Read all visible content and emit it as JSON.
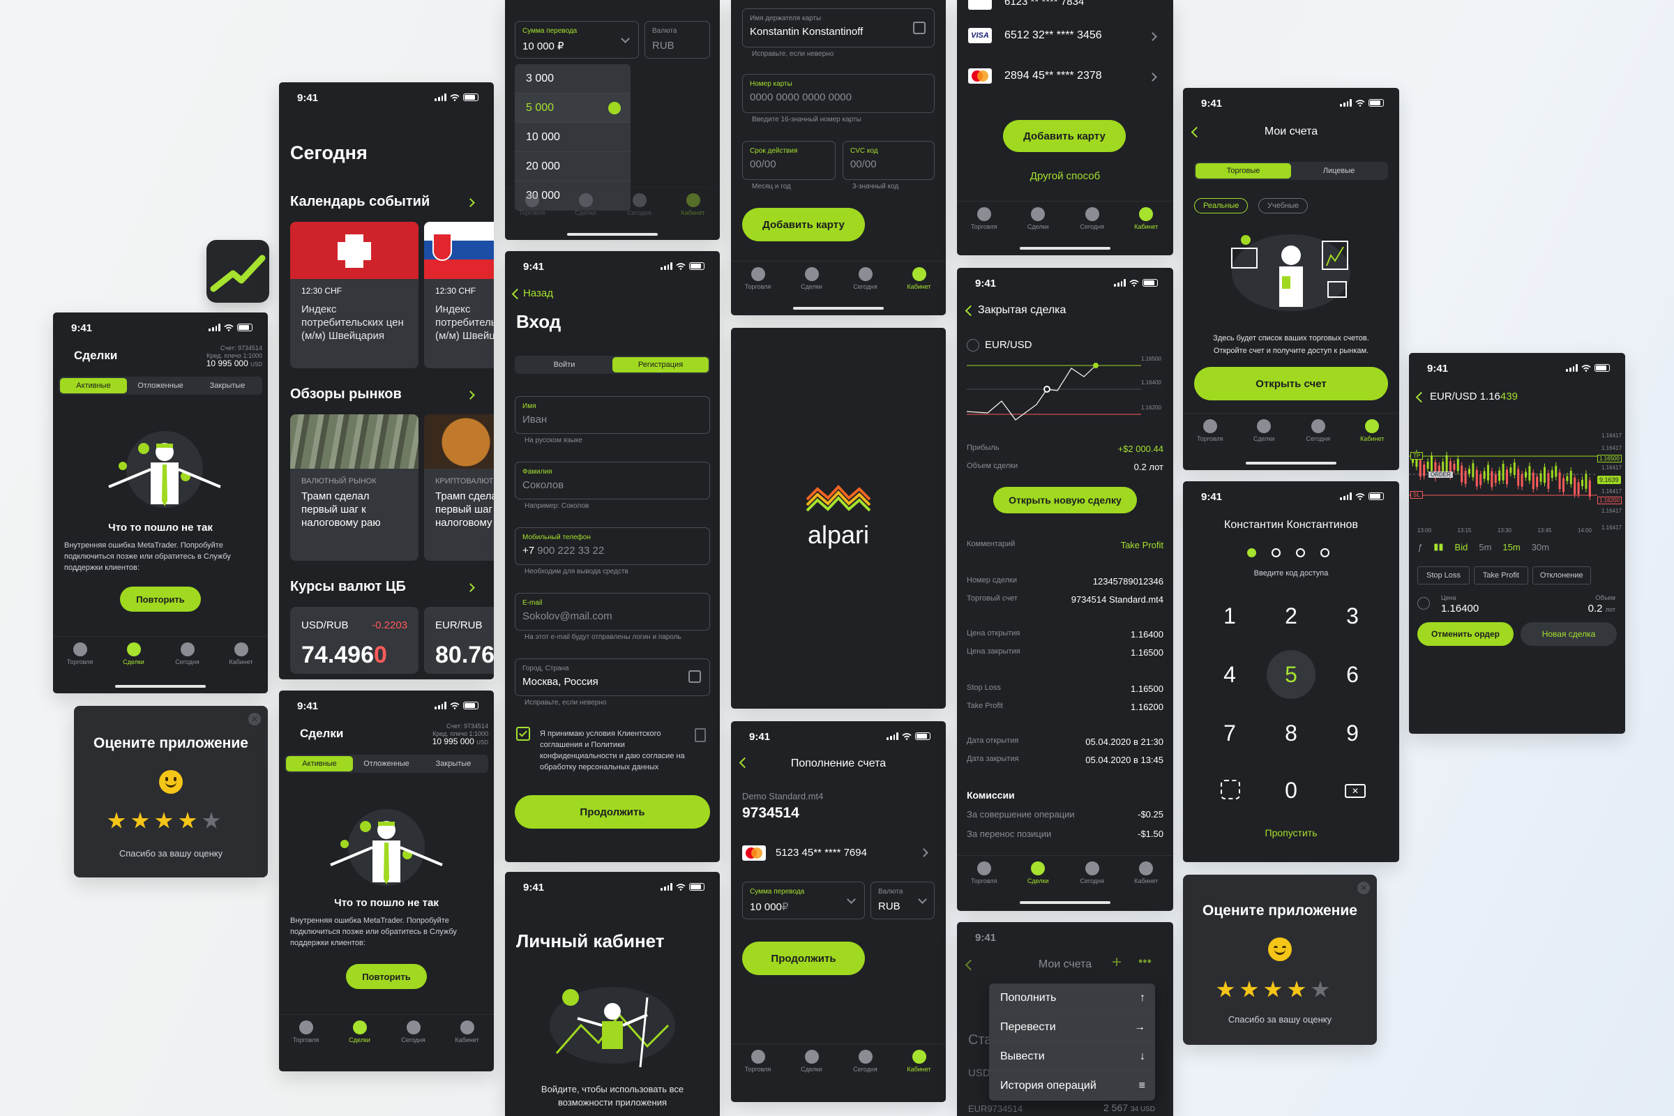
{
  "status_time": "9:41",
  "tabs": [
    "Торговля",
    "Сделки",
    "Сегодня",
    "Кабинет"
  ],
  "deals1": {
    "title": "Сделки",
    "acc": "Счет: 9734514",
    "leverage": "Кред. плечо 1:1000",
    "balance": "10 995 000",
    "cur": "USD",
    "seg": [
      "Активные",
      "Отложенные",
      "Закрытые"
    ],
    "err_title": "Что то пошло не так",
    "err_text": "Внутренняя ошибка MetaTrader. Попробуйте подключиться позже или обратитесь в Службу поддержки клиентов:",
    "retry": "Повторить"
  },
  "rate1": {
    "title": "Оцените приложение",
    "thanks": "Спасибо за вашу оценку"
  },
  "today": {
    "title": "Сегодня",
    "cal": "Календарь событий",
    "events": [
      {
        "time": "12:30 CHF",
        "text": "Индекс потребительских цен (м/м) Швейцария"
      },
      {
        "time": "12:30 CHF",
        "text": "Индекс потребительских цен (м/м) Швейцария"
      }
    ],
    "reviews": "Обзоры рынков",
    "news": [
      {
        "cat": "ВАЛЮТНЫЙ РЫНОК",
        "text": "Трамп сделал первый шаг к налоговому раю"
      },
      {
        "cat": "КРИПТОВАЛЮТЫ",
        "text": "Трамп сделал первый шаг к налоговому раю"
      }
    ],
    "rates": "Курсы валют ЦБ",
    "pairs": [
      {
        "pair": "USD/RUB",
        "chg": "-0.2203",
        "main": "74.496",
        "last": "0"
      },
      {
        "pair": "EUR/RUB",
        "main": "80.76"
      }
    ]
  },
  "transfer": {
    "amount_label": "Сумма перевода",
    "amount": "10 000 ₽",
    "cur_label": "Валюта",
    "cur": "RUB",
    "options": [
      "3 000",
      "5 000",
      "10 000",
      "20 000",
      "30 000"
    ]
  },
  "login": {
    "back": "Назад",
    "title": "Вход",
    "seg": [
      "Войти",
      "Регистрация"
    ],
    "fields": [
      {
        "label": "Имя",
        "value": "Иван",
        "hint": "На русском языке"
      },
      {
        "label": "Фамилия",
        "value": "Соколов",
        "hint": "Например: Соколов"
      },
      {
        "label": "Мобильный телефон",
        "prefix": "+7",
        "value": "900 222 33 22",
        "hint": "Необходим для вывода средств"
      },
      {
        "label": "E-mail",
        "value": "Sokolov@mail.com",
        "hint": "На этот e-mail будут отправлены логин и пароль"
      },
      {
        "label": "Город, Страна",
        "value": "Москва, Россия",
        "hint": "Исправьте, если неверно"
      }
    ],
    "agree": "Я принимаю условия Клиентского соглашения и Политики конфиденциальности и даю согласие на обработку персональных данных",
    "cont": "Продолжить"
  },
  "cabinet": {
    "title": "Личный кабинет",
    "text": "Войдите, чтобы использовать все возможности приложения"
  },
  "card_form": {
    "holder_label": "Имя держателя карты",
    "holder": "Konstantin Konstantinoff",
    "holder_hint": "Исправьте, если неверно",
    "num_label": "Номер карты",
    "num": "0000 0000 0000 0000",
    "num_hint": "Введите 16-значный номер карты",
    "exp_label": "Срок действия",
    "exp": "00/00",
    "exp_hint": "Месяц и год",
    "cvc_label": "CVC код",
    "cvc": "00/00",
    "cvc_hint": "3-значный код",
    "add": "Добавить карту"
  },
  "brand": {
    "name": "alpari"
  },
  "deposit": {
    "title": "Пополнение счета",
    "acc_type": "Demo Standard.mt4",
    "acc": "9734514",
    "card": "5123  45** **** 7694",
    "amount_label": "Сумма перевода",
    "amount": "10 000",
    "rub": "₽",
    "cur_label": "Валюта",
    "cur": "RUB",
    "cont": "Продолжить"
  },
  "cards": {
    "top_card": "6123  ** **** 7834",
    "visa": "6512  32** **** 3456",
    "mc": "2894  45** **** 2378",
    "add": "Добавить карту",
    "other": "Другой способ"
  },
  "closed": {
    "title": "Закрытая сделка",
    "pair": "EUR/USD",
    "ticks": [
      "1.16500",
      "1.16400",
      "1.16200"
    ],
    "profit_k": "Прибыль",
    "profit": "+$2 000.44",
    "vol_k": "Объем сделки",
    "vol": "0.2 лот",
    "open_btn": "Открыть новую сделку",
    "comment_k": "Комментарий",
    "comment": "Take Profit",
    "rows": [
      [
        "Номер сделки",
        "12345789012346"
      ],
      [
        "Торговый счет",
        "9734514 Standard.mt4"
      ],
      [
        "Цена открытия",
        "1.16400"
      ],
      [
        "Цена закрытия",
        "1.16500"
      ],
      [
        "Stop Loss",
        "1.16500"
      ],
      [
        "Take Profit",
        "1.16200"
      ],
      [
        "Дата открытия",
        "05.04.2020 в 21:30"
      ],
      [
        "Дата закрытия",
        "05.04.2020 в 13:45"
      ]
    ],
    "fees": "Комиссии",
    "fee_rows": [
      [
        "За совершение операции",
        "-$0.25"
      ],
      [
        "За перенос позиции",
        "-$1.50"
      ]
    ]
  },
  "menu": {
    "title": "Мои счета",
    "items": [
      "Пополнить",
      "Перевести",
      "Вывести",
      "История операций"
    ],
    "peek1": "Ста",
    "peek2": "USD",
    "peek3": "EUR9734514",
    "peek4": "2 567",
    "peek5": "34 USD"
  },
  "accounts": {
    "title": "Мои счета",
    "seg": [
      "Торговые",
      "Лицевые"
    ],
    "pills": [
      "Реальные",
      "Учебные"
    ],
    "text": "Здесь будет список ваших торговых счетов. Откройте счет и получите доступ к рынкам.",
    "open": "Открыть счет"
  },
  "pin": {
    "name": "Константин Константинов",
    "hint": "Введите код доступа",
    "keys": [
      "1",
      "2",
      "3",
      "4",
      "5",
      "6",
      "7",
      "8",
      "9",
      "0"
    ],
    "skip": "Пропустить"
  },
  "rate2": {
    "title": "Оцените приложение",
    "thanks": "Спасибо за вашу оценку"
  },
  "deals2": {
    "title": "Сделки",
    "acc": "Счет: 9734514",
    "leverage": "Кред. плечо 1:1000",
    "balance": "10 995 000",
    "cur": "USD",
    "seg": [
      "Активные",
      "Отложенные",
      "Закрытые"
    ],
    "err_title": "Что то пошло не так",
    "err_text": "Внутренняя ошибка MetaTrader. Попробуйте подключиться позже или обратитесь в Службу поддержки клиентов:",
    "retry": "Повторить"
  },
  "trade": {
    "pair": "EUR/USD",
    "price_a": "1.16",
    "price_b": "439",
    "yticks": [
      "1.16417",
      "1.16417",
      "1.16500",
      "1.16417",
      "1.16417",
      "1.16417",
      "1.16200",
      "1.16417"
    ],
    "xticks": [
      "13:00",
      "13:15",
      "13:30",
      "13:45",
      "14:00"
    ],
    "tp": "TP",
    "order": "ORDER",
    "sl": "SL",
    "cur_price": "9.1639",
    "tf": [
      "Bid",
      "5m",
      "15m",
      "30m"
    ],
    "btns": [
      "Stop Loss",
      "Take Profit",
      "Отклонение"
    ],
    "price_k": "Цена",
    "price": "1.16400",
    "vol_k": "Объем",
    "vol": "0.2",
    "vol_u": "лот",
    "cancel": "Отменить ордер",
    "new": "Новая сделка"
  }
}
